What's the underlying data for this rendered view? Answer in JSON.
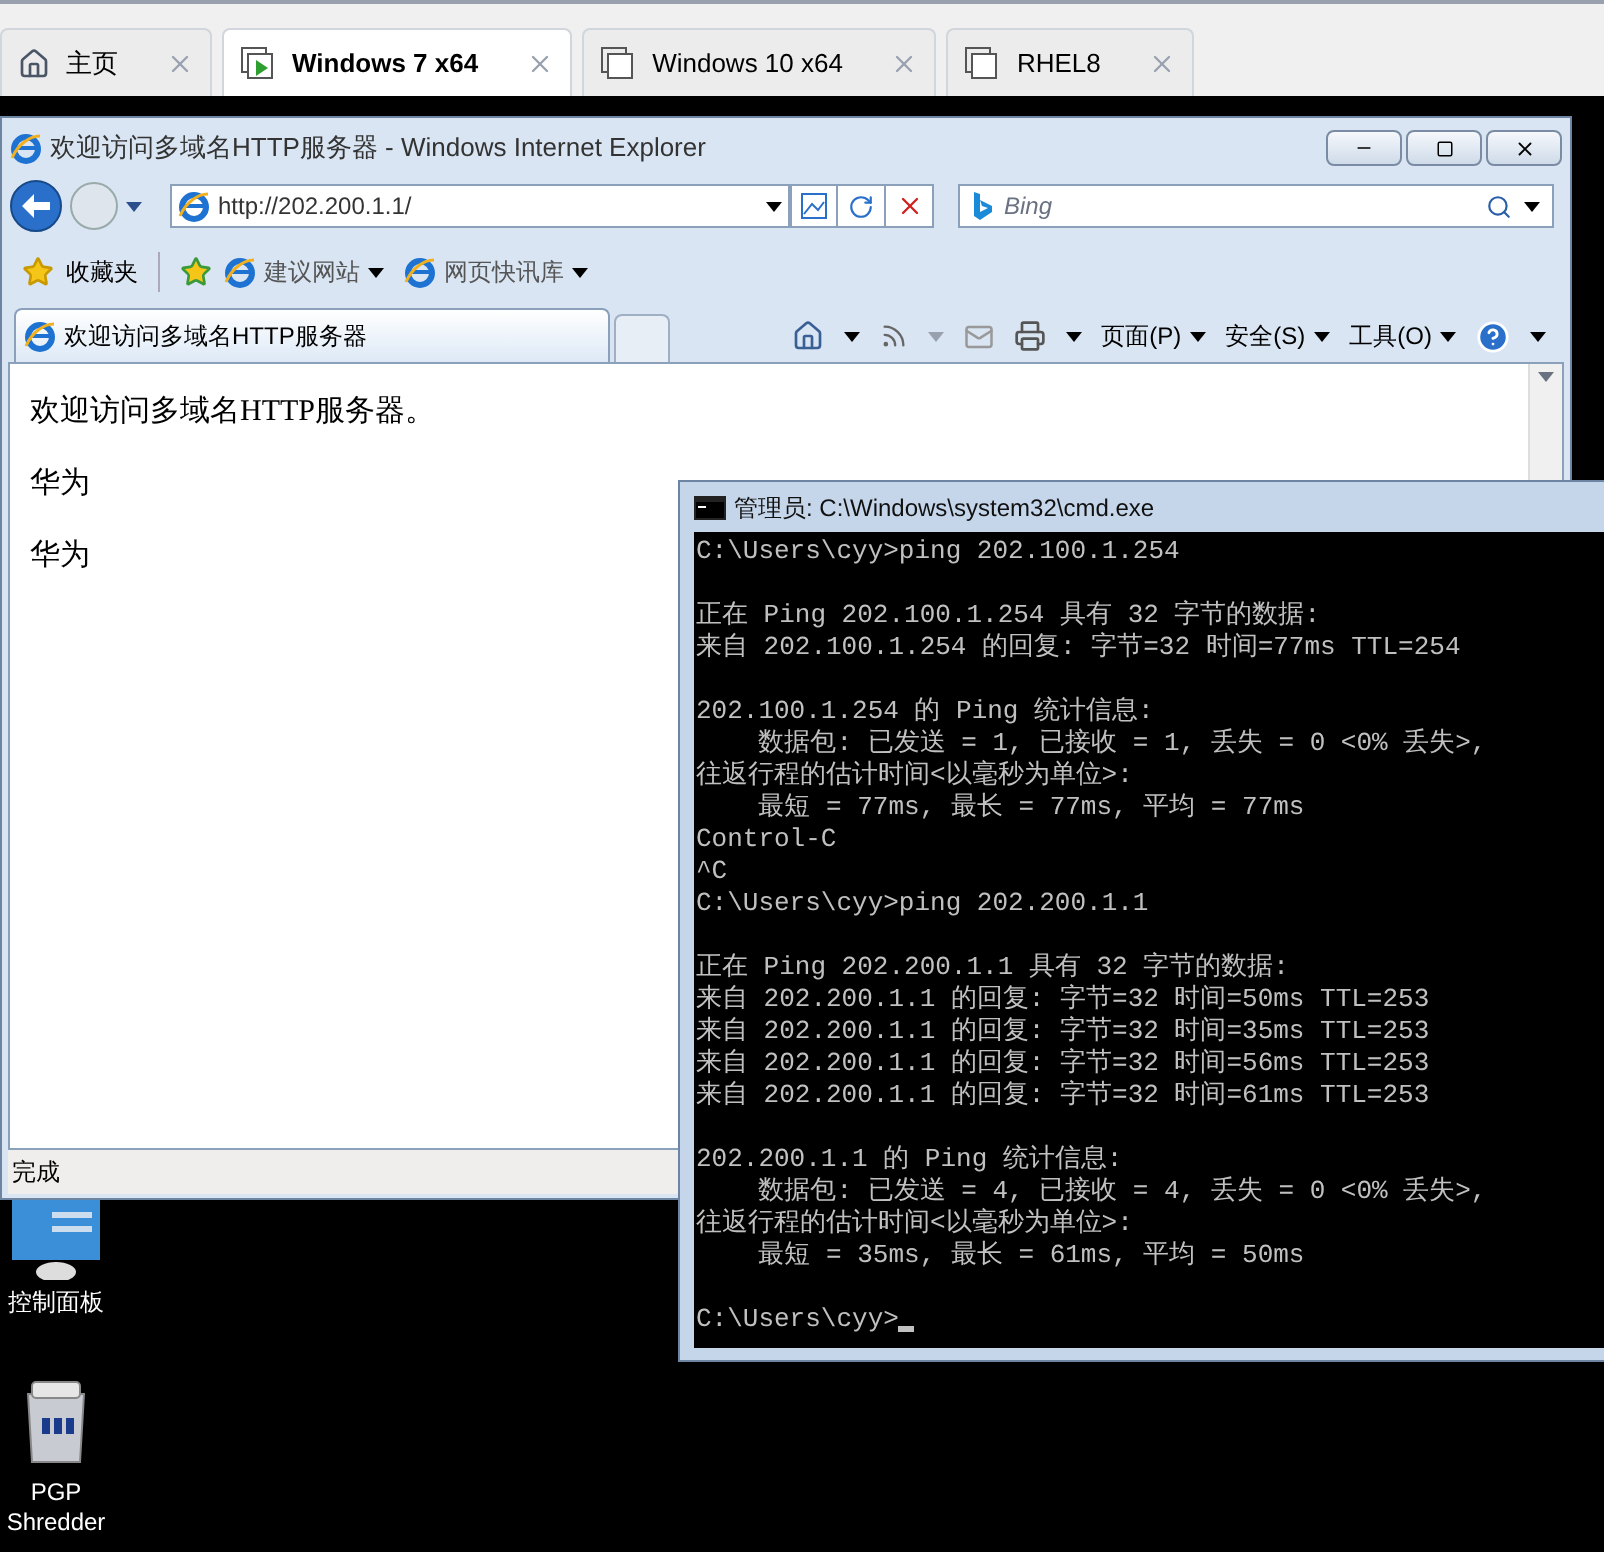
{
  "vm_tabs": [
    {
      "label": "主页",
      "kind": "home",
      "selected": false
    },
    {
      "label": "Windows 7 x64",
      "kind": "vm",
      "selected": true
    },
    {
      "label": "Windows 10 x64",
      "kind": "vm",
      "selected": false
    },
    {
      "label": "RHEL8",
      "kind": "vm",
      "selected": false
    }
  ],
  "browser": {
    "title": "欢迎访问多域名HTTP服务器 - Windows Internet Explorer",
    "address": "http://202.200.1.1/",
    "search_placeholder": "Bing",
    "favorites_label": "收藏夹",
    "favorite_links": [
      "建议网站",
      "网页快讯库"
    ],
    "tab_label": "欢迎访问多域名HTTP服务器",
    "menus": [
      "页面(P)",
      "安全(S)",
      "工具(O)"
    ],
    "page_lines": [
      "欢迎访问多域名HTTP服务器。",
      "华为",
      "华为"
    ],
    "status": "完成"
  },
  "console": {
    "title": "管理员: C:\\Windows\\system32\\cmd.exe",
    "blocks": [
      [
        "C:\\Users\\cyy>ping 202.100.1.254"
      ],
      [
        "正在 Ping 202.100.1.254 具有 32 字节的数据:",
        "来自 202.100.1.254 的回复: 字节=32 时间=77ms TTL=254"
      ],
      [
        "202.100.1.254 的 Ping 统计信息:",
        "    数据包: 已发送 = 1, 已接收 = 1, 丢失 = 0 <0% 丢失>,",
        "往返行程的估计时间<以毫秒为单位>:",
        "    最短 = 77ms, 最长 = 77ms, 平均 = 77ms",
        "Control-C",
        "^C",
        "C:\\Users\\cyy>ping 202.200.1.1"
      ],
      [
        "正在 Ping 202.200.1.1 具有 32 字节的数据:",
        "来自 202.200.1.1 的回复: 字节=32 时间=50ms TTL=253",
        "来自 202.200.1.1 的回复: 字节=32 时间=35ms TTL=253",
        "来自 202.200.1.1 的回复: 字节=32 时间=56ms TTL=253",
        "来自 202.200.1.1 的回复: 字节=32 时间=61ms TTL=253"
      ],
      [
        "202.200.1.1 的 Ping 统计信息:",
        "    数据包: 已发送 = 4, 已接收 = 4, 丢失 = 0 <0% 丢失>,",
        "往返行程的估计时间<以毫秒为单位>:",
        "    最短 = 35ms, 最长 = 61ms, 平均 = 50ms"
      ]
    ],
    "prompt": "C:\\Users\\cyy>"
  },
  "desktop_icons": [
    {
      "label": "控制面板",
      "kind": "panel"
    },
    {
      "label": "PGP Shredder",
      "kind": "shredder"
    }
  ]
}
